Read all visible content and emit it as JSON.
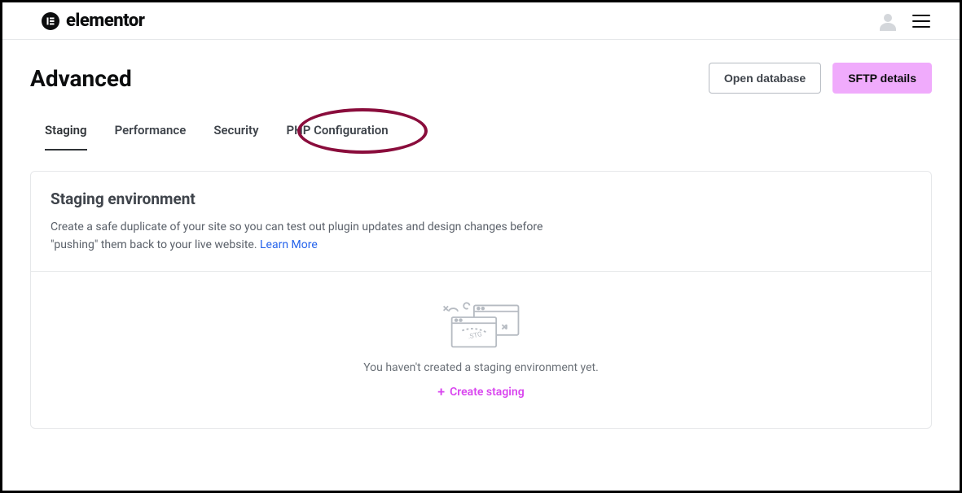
{
  "brand": {
    "name": "elementor",
    "mark": "E"
  },
  "page": {
    "title": "Advanced"
  },
  "header_actions": {
    "open_db": "Open database",
    "sftp": "SFTP details"
  },
  "tabs": {
    "staging": "Staging",
    "performance": "Performance",
    "security": "Security",
    "php_config": "PHP Configuration"
  },
  "panel": {
    "title": "Staging environment",
    "desc_part1": "Create a safe duplicate of your site so you can test out plugin updates and design changes before \"pushing\" them back to your live website. ",
    "learn_more": "Learn More",
    "empty_text": "You haven't created a staging environment yet.",
    "create_label": "Create staging"
  }
}
